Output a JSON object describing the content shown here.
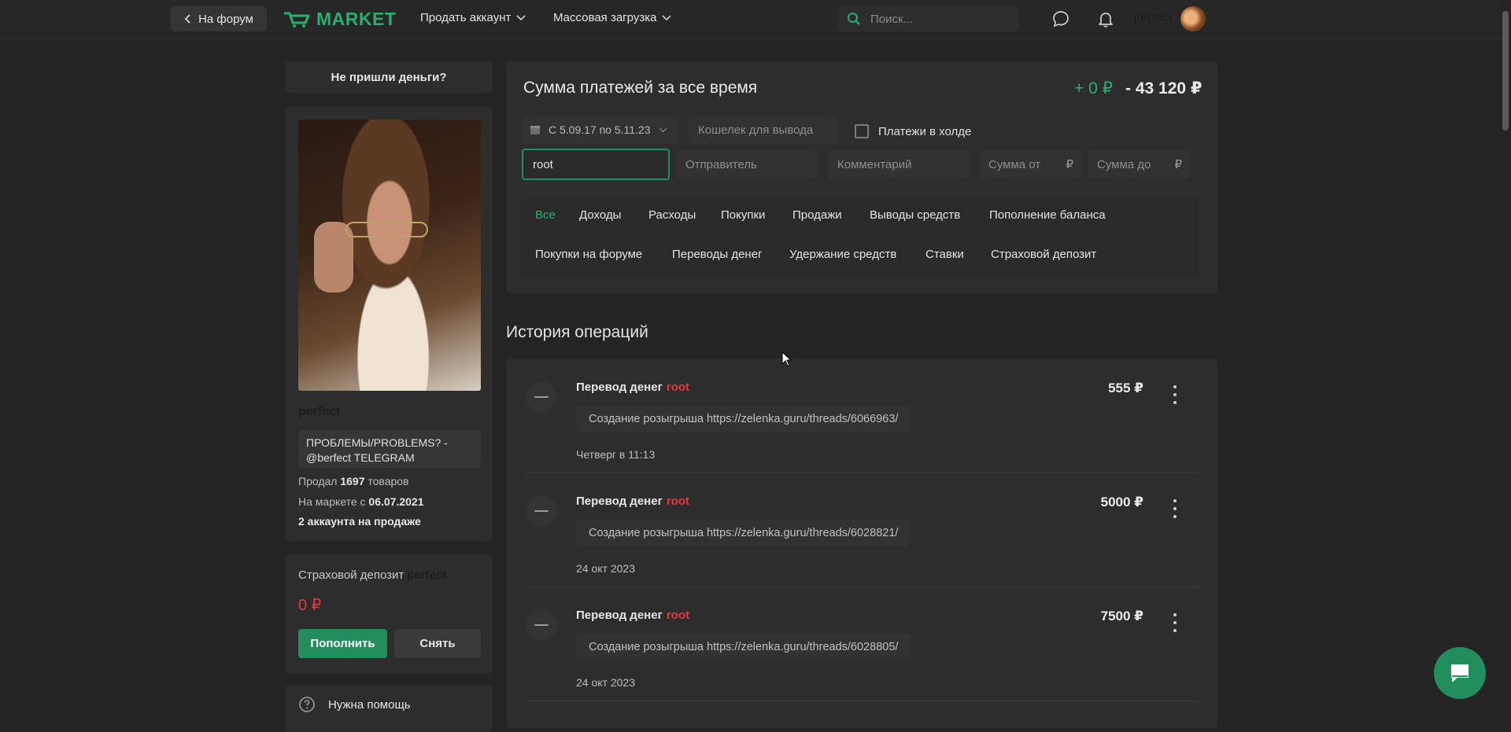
{
  "topbar": {
    "back_label": "На форум",
    "logo_text": "MARKET",
    "nav": [
      {
        "label": "Продать аккаунт"
      },
      {
        "label": "Массовая загрузка"
      }
    ],
    "search_placeholder": "Поиск...",
    "username": "perfect"
  },
  "sidebar": {
    "not_received": "Не пришли деньги?",
    "profile": {
      "name": "perfect",
      "status": "ПРОБЛЕМЫ/PROBLEMS? - @berfect TELEGRAM",
      "sold_prefix": "Продал",
      "sold_count": "1697",
      "sold_suffix": "товаров",
      "since_prefix": "На маркете с",
      "since_date": "06.07.2021",
      "on_sale": "2 аккаунта на продаже"
    },
    "deposit": {
      "title": "Страховой депозит",
      "owner": "perfect",
      "amount": "0 ₽",
      "topup_label": "Пополнить",
      "withdraw_label": "Снять"
    },
    "help_label": "Нужна помощь"
  },
  "payments": {
    "title": "Сумма платежей за все время",
    "income": "+ 0 ₽",
    "outcome": "- 43 120 ₽",
    "date_range": "С 5.09.17 по 5.11.23",
    "wallet_placeholder": "Кошелек для вывода",
    "hold_label": "Платежи в холде",
    "receiver_value": "root",
    "sender_placeholder": "Отправитель",
    "comment_placeholder": "Комментарий",
    "sum_from_placeholder": "Сумма от",
    "sum_to_placeholder": "Сумма до",
    "currency": "₽",
    "filters_row1": [
      "Все",
      "Доходы",
      "Расходы",
      "Покупки",
      "Продажи",
      "Выводы средств",
      "Пополнение баланса"
    ],
    "filters_row2": [
      "Покупки на форуме",
      "Переводы денег",
      "Удержание средств",
      "Ставки",
      "Страховой депозит"
    ],
    "active_filter": "Все"
  },
  "history": {
    "title": "История операций",
    "operations": [
      {
        "title": "Перевод денег",
        "user": "root",
        "comment": "Создание розыгрыша https://zelenka.guru/threads/6066963/",
        "date": "Четверг в 11:13",
        "amount": "555 ₽"
      },
      {
        "title": "Перевод денег",
        "user": "root",
        "comment": "Создание розыгрыша https://zelenka.guru/threads/6028821/",
        "date": "24 окт 2023",
        "amount": "5000 ₽"
      },
      {
        "title": "Перевод денег",
        "user": "root",
        "comment": "Создание розыгрыша https://zelenka.guru/threads/6028805/",
        "date": "24 окт 2023",
        "amount": "7500 ₽"
      }
    ]
  },
  "colors": {
    "accent_green": "#228e5d",
    "accent_green_text": "#2bad72",
    "negative_red": "#e0393e",
    "background": "#242424",
    "card": "#2d2d2d"
  }
}
